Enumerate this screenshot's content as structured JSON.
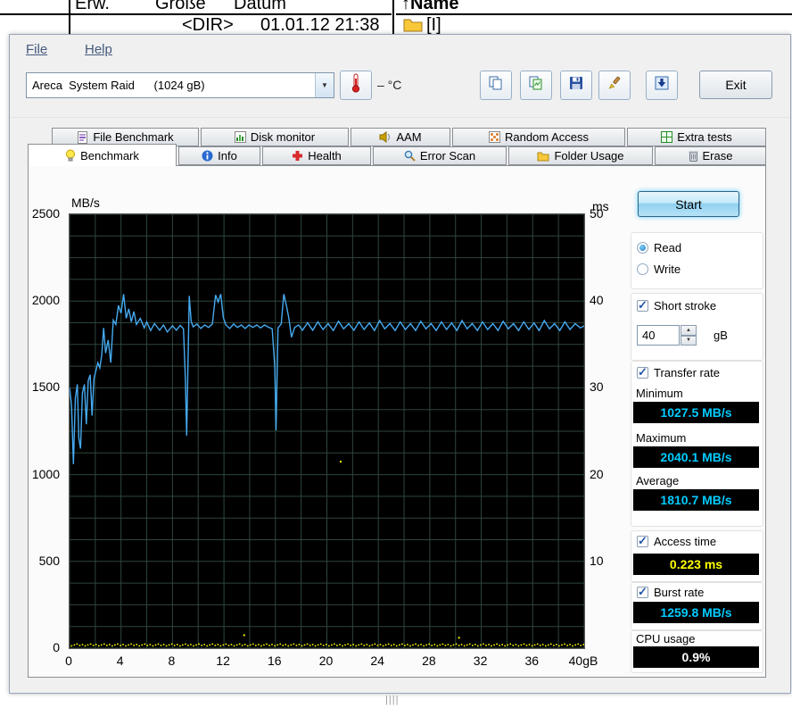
{
  "background_window": {
    "col_erw": "Erw.",
    "col_groesse": "Größe",
    "col_datum": "Datum",
    "cell_dir": "<DIR>",
    "cell_date": "01.01.12 21:38",
    "sort_arrow": "↑",
    "col_name": "Name",
    "folder_label": "[I]",
    "resize_handle": "||||"
  },
  "menu": {
    "file": "File",
    "help": "Help"
  },
  "toolbar": {
    "drive_select": "Areca  System Raid      (1024 gB)",
    "temperature": "– °C",
    "exit": "Exit"
  },
  "tabs": {
    "row1": [
      {
        "label": "File Benchmark",
        "icon": "file-benchmark-icon"
      },
      {
        "label": "Disk monitor",
        "icon": "disk-monitor-icon"
      },
      {
        "label": "AAM",
        "icon": "aam-icon"
      },
      {
        "label": "Random Access",
        "icon": "random-access-icon"
      },
      {
        "label": "Extra tests",
        "icon": "extra-tests-icon"
      }
    ],
    "row2": [
      {
        "label": "Benchmark",
        "icon": "benchmark-icon",
        "active": true
      },
      {
        "label": "Info",
        "icon": "info-icon"
      },
      {
        "label": "Health",
        "icon": "health-icon"
      },
      {
        "label": "Error Scan",
        "icon": "error-scan-icon"
      },
      {
        "label": "Folder Usage",
        "icon": "folder-usage-icon"
      },
      {
        "label": "Erase",
        "icon": "erase-icon"
      }
    ]
  },
  "panel": {
    "start": "Start",
    "read": {
      "label": "Read",
      "selected": true
    },
    "write": {
      "label": "Write",
      "selected": false
    },
    "short_stroke": {
      "label": "Short stroke",
      "checked": true,
      "value": "40",
      "unit": "gB"
    },
    "transfer_rate": {
      "label": "Transfer rate",
      "checked": true,
      "minimum": {
        "label": "Minimum",
        "value": "1027.5 MB/s"
      },
      "maximum": {
        "label": "Maximum",
        "value": "2040.1 MB/s"
      },
      "average": {
        "label": "Average",
        "value": "1810.7 MB/s"
      }
    },
    "access_time": {
      "label": "Access time",
      "checked": true,
      "value": "0.223 ms"
    },
    "burst_rate": {
      "label": "Burst rate",
      "checked": true,
      "value": "1259.8 MB/s"
    },
    "cpu_usage": {
      "label": "CPU usage",
      "value": "0.9%"
    }
  },
  "colors": {
    "value_cyan": "#00ccff",
    "value_yellow": "#ffff00",
    "value_white": "#ffffff",
    "transfer_line_blue": "#46aaf0",
    "access_dots_yellow": "#f8f800",
    "plot_background": "#000000"
  },
  "chart_data": {
    "type": "line",
    "title": "",
    "x_unit": "gB",
    "x_range": [
      0,
      40
    ],
    "x_ticks": [
      0,
      4,
      8,
      12,
      16,
      20,
      24,
      28,
      32,
      36,
      40
    ],
    "y_left": {
      "label": "MB/s",
      "range": [
        0,
        2500
      ],
      "ticks": [
        0,
        500,
        1000,
        1500,
        2000,
        2500
      ]
    },
    "y_right": {
      "label": "ms",
      "range": [
        0,
        50
      ],
      "ticks": [
        10,
        20,
        30,
        40,
        50
      ]
    },
    "grid": {
      "x_step": 2,
      "y_step": 125,
      "color": "#2e463c"
    },
    "series": [
      {
        "name": "Transfer rate",
        "unit": "MB/s",
        "color": "#46aaf0",
        "style": "line",
        "points": [
          [
            0,
            1500
          ],
          [
            0.15,
            1400
          ],
          [
            0.3,
            1060
          ],
          [
            0.45,
            1440
          ],
          [
            0.6,
            1520
          ],
          [
            0.72,
            1210
          ],
          [
            0.85,
            1150
          ],
          [
            1,
            1470
          ],
          [
            1.15,
            1520
          ],
          [
            1.3,
            1290
          ],
          [
            1.45,
            1540
          ],
          [
            1.6,
            1575
          ],
          [
            1.75,
            1340
          ],
          [
            1.9,
            1555
          ],
          [
            2.05,
            1600
          ],
          [
            2.2,
            1645
          ],
          [
            2.35,
            1615
          ],
          [
            2.5,
            1690
          ],
          [
            2.65,
            1845
          ],
          [
            2.8,
            1700
          ],
          [
            3,
            1775
          ],
          [
            3.2,
            1645
          ],
          [
            3.4,
            1890
          ],
          [
            3.6,
            1865
          ],
          [
            3.8,
            1975
          ],
          [
            4,
            1930
          ],
          [
            4.2,
            2040
          ],
          [
            4.4,
            1900
          ],
          [
            4.6,
            1955
          ],
          [
            4.8,
            1880
          ],
          [
            5,
            1940
          ],
          [
            5.2,
            1865
          ],
          [
            5.5,
            1900
          ],
          [
            5.8,
            1845
          ],
          [
            6,
            1880
          ],
          [
            6.3,
            1830
          ],
          [
            6.6,
            1870
          ],
          [
            7,
            1832
          ],
          [
            7.3,
            1862
          ],
          [
            7.6,
            1822
          ],
          [
            8,
            1858
          ],
          [
            8.3,
            1832
          ],
          [
            8.6,
            1860
          ],
          [
            8.85,
            1840
          ],
          [
            9,
            1560
          ],
          [
            9.1,
            1225
          ],
          [
            9.22,
            1700
          ],
          [
            9.3,
            2030
          ],
          [
            9.45,
            1885
          ],
          [
            9.6,
            1852
          ],
          [
            9.9,
            1868
          ],
          [
            10.2,
            1842
          ],
          [
            10.5,
            1862
          ],
          [
            10.8,
            1848
          ],
          [
            11.1,
            1868
          ],
          [
            11.35,
            2035
          ],
          [
            11.55,
            1995
          ],
          [
            11.75,
            2040
          ],
          [
            11.95,
            1905
          ],
          [
            12.15,
            1862
          ],
          [
            12.45,
            1842
          ],
          [
            12.75,
            1868
          ],
          [
            13.05,
            1848
          ],
          [
            13.35,
            1862
          ],
          [
            13.65,
            1842
          ],
          [
            13.95,
            1862
          ],
          [
            14.25,
            1848
          ],
          [
            14.55,
            1862
          ],
          [
            14.85,
            1845
          ],
          [
            15.15,
            1862
          ],
          [
            15.45,
            1850
          ],
          [
            15.75,
            1840
          ],
          [
            15.95,
            1620
          ],
          [
            16.05,
            1255
          ],
          [
            16.2,
            1845
          ],
          [
            16.45,
            1868
          ],
          [
            16.65,
            2040
          ],
          [
            16.85,
            1975
          ],
          [
            17.05,
            1900
          ],
          [
            17.25,
            1792
          ],
          [
            17.5,
            1848
          ],
          [
            17.8,
            1862
          ],
          [
            18.1,
            1832
          ],
          [
            18.5,
            1875
          ],
          [
            18.9,
            1832
          ],
          [
            19.3,
            1880
          ],
          [
            19.7,
            1836
          ],
          [
            20.1,
            1870
          ],
          [
            20.5,
            1830
          ],
          [
            20.9,
            1884
          ],
          [
            21.3,
            1840
          ],
          [
            21.7,
            1870
          ],
          [
            22.1,
            1832
          ],
          [
            22.5,
            1880
          ],
          [
            22.9,
            1836
          ],
          [
            23.3,
            1874
          ],
          [
            23.7,
            1830
          ],
          [
            24.1,
            1888
          ],
          [
            24.5,
            1840
          ],
          [
            24.9,
            1870
          ],
          [
            25.3,
            1830
          ],
          [
            25.7,
            1880
          ],
          [
            26.1,
            1836
          ],
          [
            26.5,
            1870
          ],
          [
            26.9,
            1830
          ],
          [
            27.3,
            1884
          ],
          [
            27.7,
            1840
          ],
          [
            28.1,
            1870
          ],
          [
            28.5,
            1830
          ],
          [
            28.9,
            1880
          ],
          [
            29.3,
            1836
          ],
          [
            29.7,
            1874
          ],
          [
            30.1,
            1830
          ],
          [
            30.5,
            1888
          ],
          [
            30.9,
            1840
          ],
          [
            31.3,
            1870
          ],
          [
            31.7,
            1830
          ],
          [
            32.1,
            1880
          ],
          [
            32.5,
            1836
          ],
          [
            32.9,
            1870
          ],
          [
            33.3,
            1830
          ],
          [
            33.7,
            1884
          ],
          [
            34.1,
            1840
          ],
          [
            34.5,
            1870
          ],
          [
            34.9,
            1830
          ],
          [
            35.3,
            1880
          ],
          [
            35.7,
            1836
          ],
          [
            36.1,
            1874
          ],
          [
            36.5,
            1830
          ],
          [
            36.9,
            1888
          ],
          [
            37.3,
            1840
          ],
          [
            37.7,
            1870
          ],
          [
            38.1,
            1830
          ],
          [
            38.5,
            1880
          ],
          [
            38.9,
            1836
          ],
          [
            39.3,
            1870
          ],
          [
            39.7,
            1845
          ],
          [
            40,
            1858
          ]
        ]
      },
      {
        "name": "Access time",
        "unit": "ms",
        "color": "#f8f800",
        "style": "dots",
        "baseline_ms": 0.25,
        "dot_count": 190,
        "stray_points": [
          [
            21,
            21.6
          ],
          [
            13.5,
            1.6
          ],
          [
            30.2,
            1.3
          ]
        ]
      }
    ]
  }
}
